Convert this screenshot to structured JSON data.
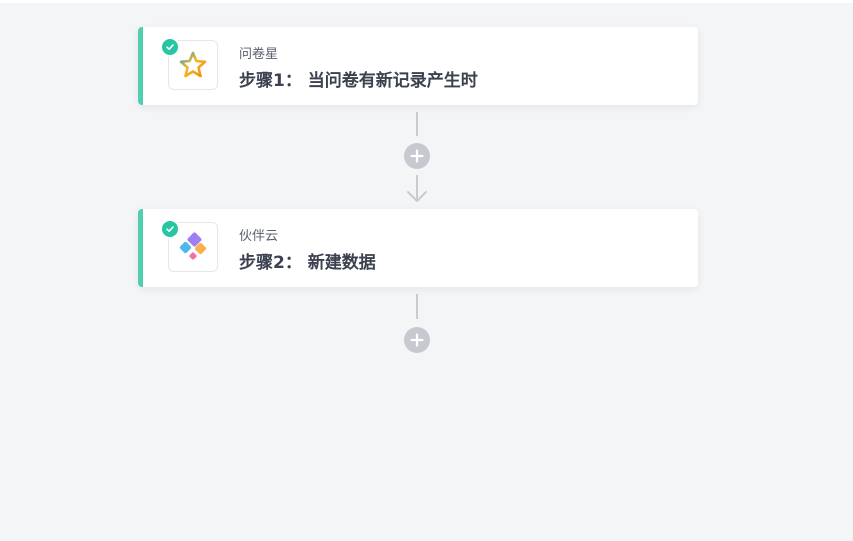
{
  "colors": {
    "background": "#f4f5f7",
    "card": "#ffffff",
    "accent": "#4fcfb0",
    "check": "#26c6a2",
    "connector": "#c8cbd1",
    "add_button": "#c6c9cf"
  },
  "steps": [
    {
      "app_name": "问卷星",
      "title": "步骤1： 当问卷有新记录产生时",
      "icon": "star-icon",
      "status": "check-icon"
    },
    {
      "app_name": "伙伴云",
      "title": "步骤2： 新建数据",
      "icon": "huoban-logo-icon",
      "status": "check-icon"
    }
  ]
}
